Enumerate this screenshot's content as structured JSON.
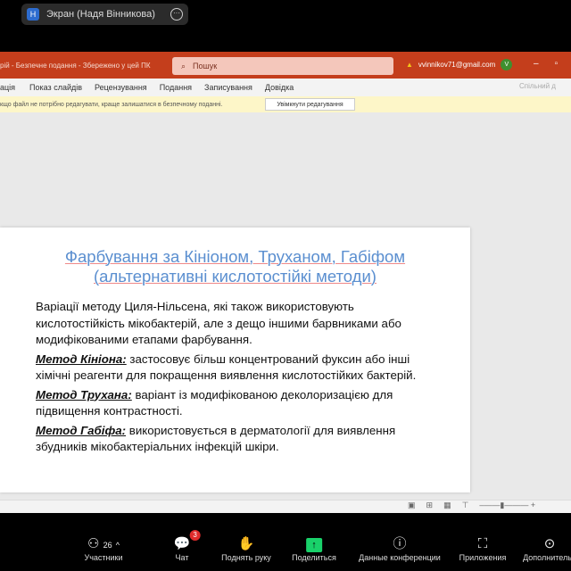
{
  "screen_share": {
    "label": "Экран (Надя Вінникова)",
    "icon": "H"
  },
  "ppt": {
    "title": "рій  -  Безпечне подання  -  Збережено у цей ПК",
    "search_placeholder": "Пошук",
    "account": "vvinnikov71@gmail.com",
    "avatar": "V",
    "tabs": [
      "ація",
      "Показ слайдів",
      "Рецензування",
      "Подання",
      "Записування",
      "Довідка"
    ],
    "share": "Спільний д",
    "protected_msg": "кщо файл не потрібно редагувати, краще залишатися в безпечному поданні.",
    "enable_editing": "Увімкнути редагування"
  },
  "slide": {
    "title_line1": "Фарбування за Кініоном, Труханом, Габіфом",
    "title_line2": "(альтернативні кислотостійкі методи)",
    "intro": "Варіації методу Циля-Нільсена, які також використовують кислотостійкість мікобактерій, але з дещо іншими барвниками або модифікованими етапами фарбування.",
    "items": [
      {
        "term": "Метод Кініона:",
        "text": " застосовує більш концентрований фуксин або інші хімічні реагенти для покращення виявлення кислотостійких бактерій."
      },
      {
        "term": "Метод Трухана:",
        "text": " варіант із модифікованою деколоризацією для підвищення контрастності."
      },
      {
        "term": "Метод Габіфа:",
        "text": " використовується в дерматології для виявлення збудників мікобактеріальних інфекцій шкіри."
      }
    ]
  },
  "toolbar": {
    "participants_count": "26",
    "chat_badge": "3",
    "items": [
      "Участники",
      "Чат",
      "Поднять руку",
      "Поделиться",
      "Данные конференции",
      "Приложения",
      "Дополнительн"
    ]
  }
}
